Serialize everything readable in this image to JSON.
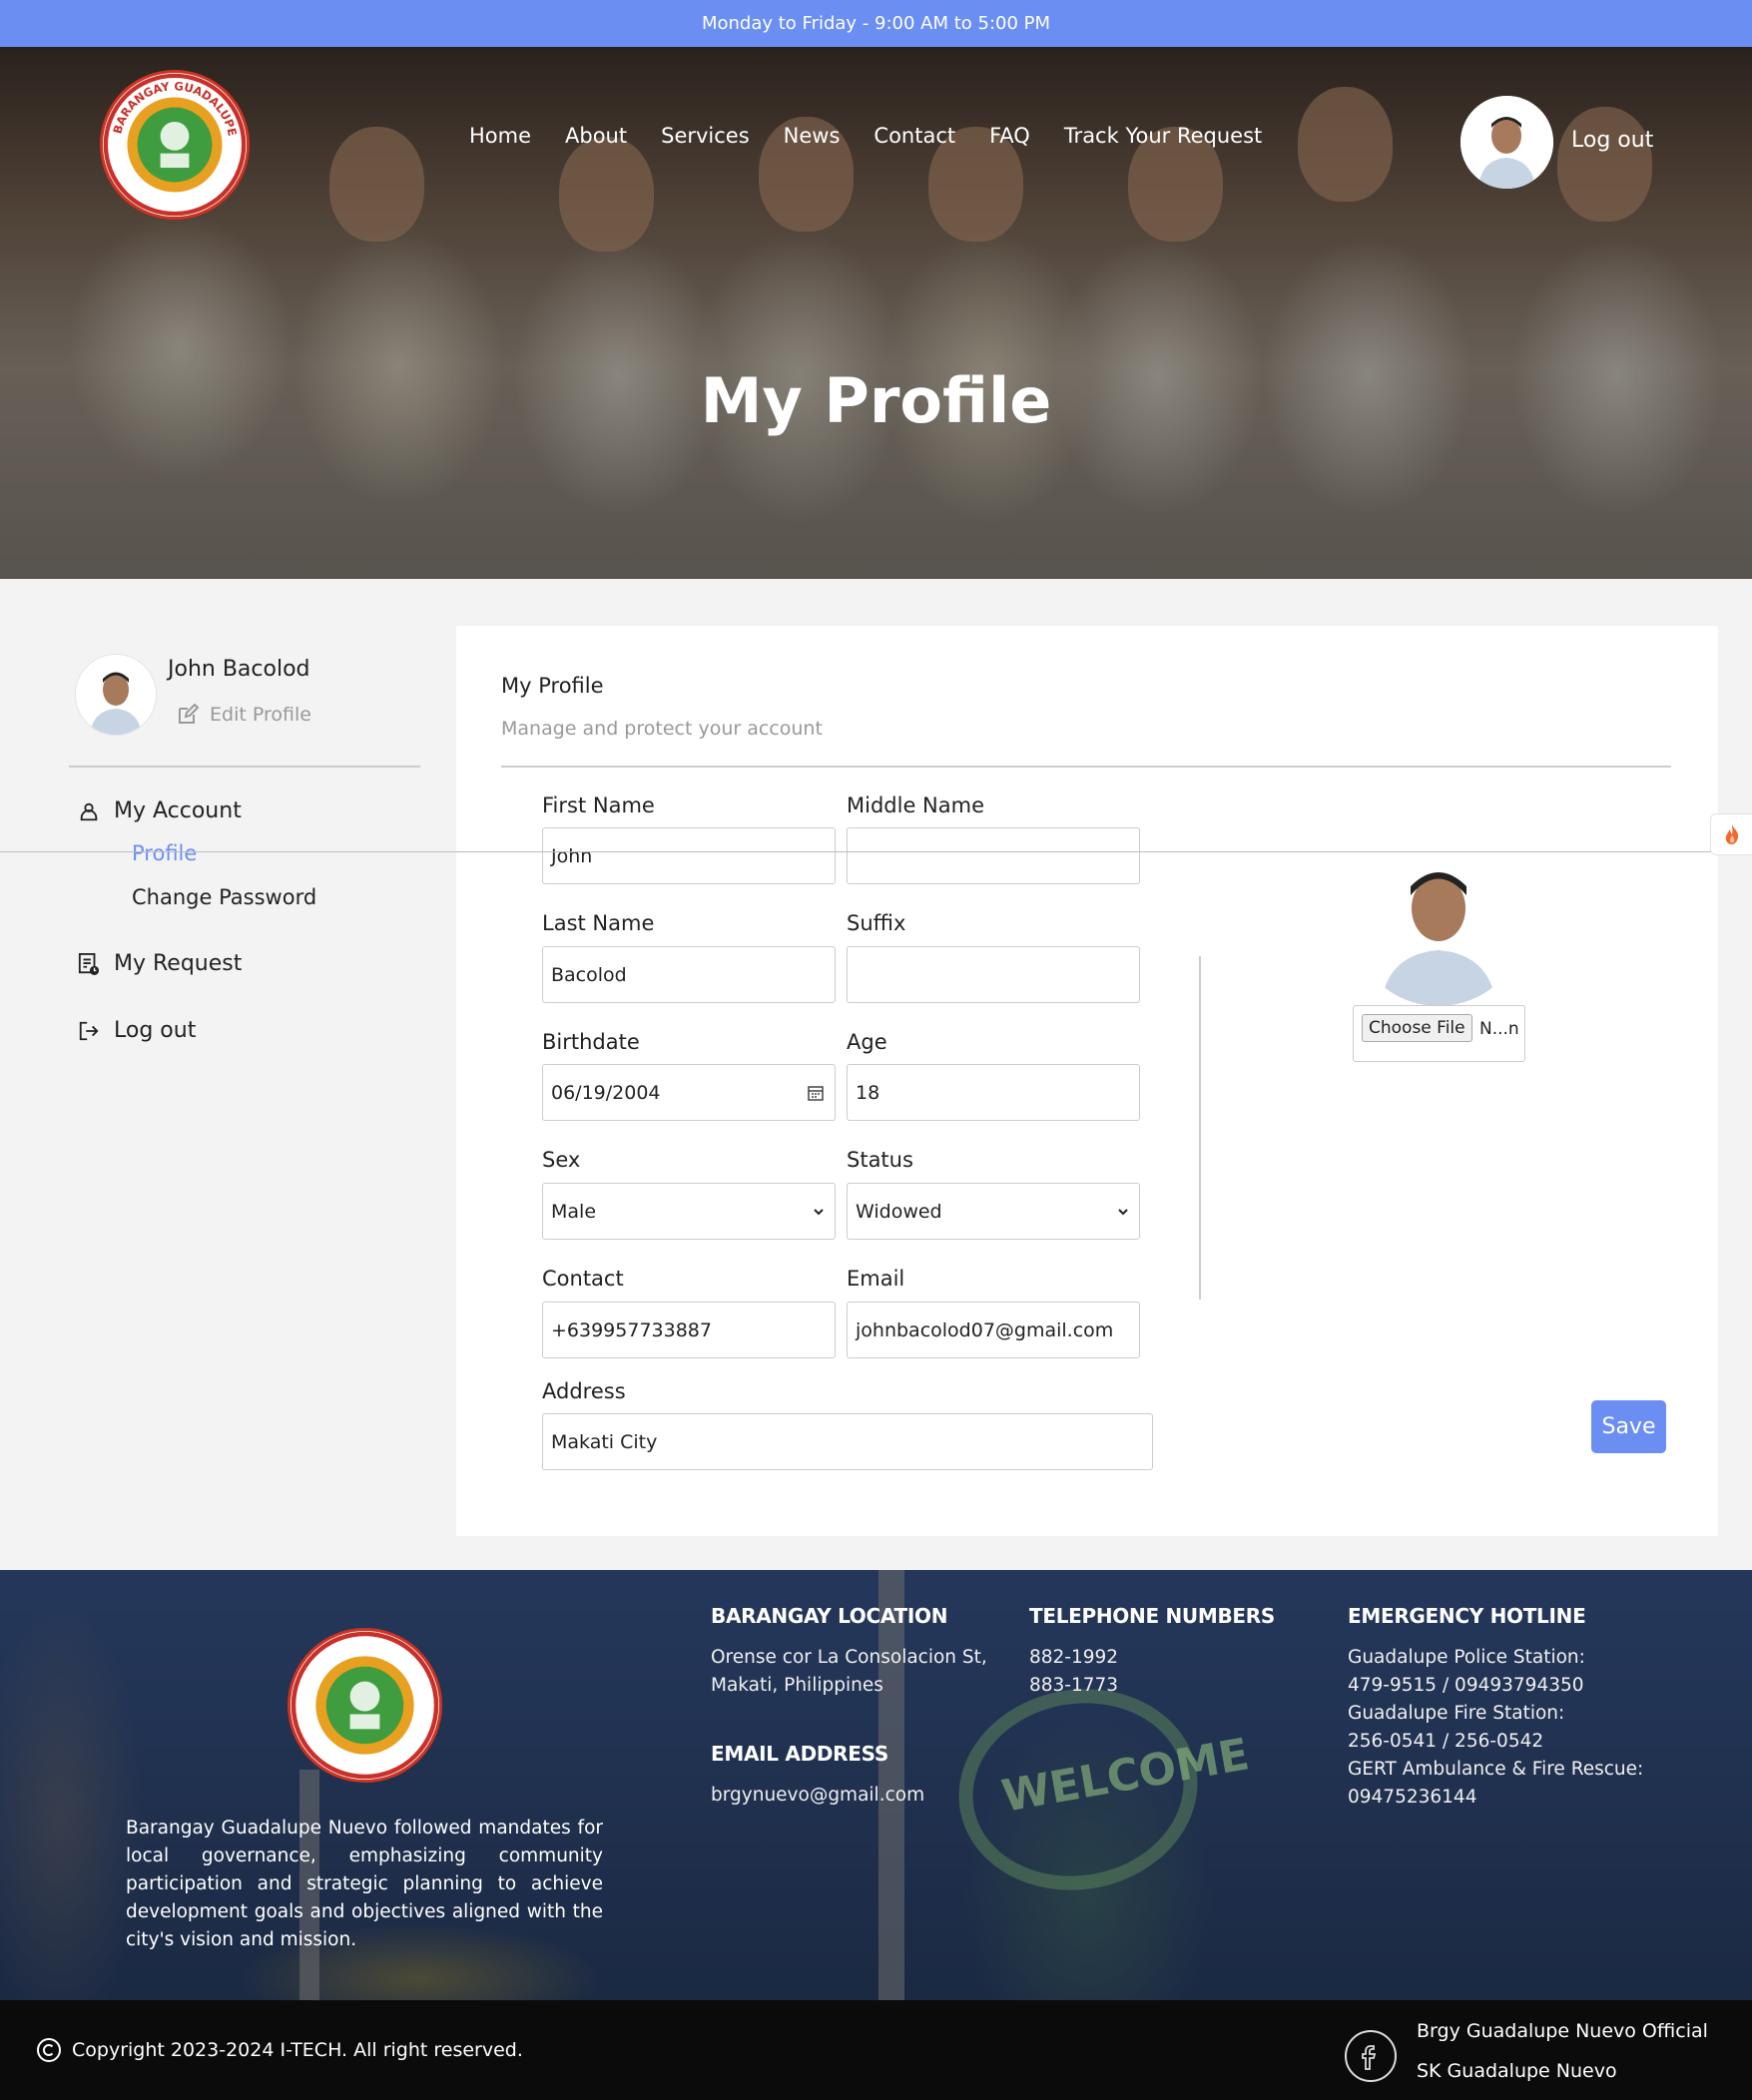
{
  "topbar": {
    "hours": "Monday to Friday - 9:00 AM to 5:00 PM"
  },
  "header": {
    "logo_text": "BARANGAY GUADALUPE NUEVO CITY OF MAKATI 2000",
    "nav": [
      "Home",
      "About",
      "Services",
      "News",
      "Contact",
      "FAQ",
      "Track Your Request"
    ],
    "logout": "Log out"
  },
  "hero": {
    "title": "My Profile"
  },
  "sidebar": {
    "name": "John Bacolod",
    "edit_profile": "Edit Profile",
    "my_account": "My Account",
    "profile": "Profile",
    "change_password": "Change Password",
    "my_request": "My Request",
    "logout": "Log out"
  },
  "form": {
    "title": "My Profile",
    "subtitle": "Manage and protect your account",
    "labels": {
      "first_name": "First Name",
      "middle_name": "Middle Name",
      "last_name": "Last Name",
      "suffix": "Suffix",
      "birthdate": "Birthdate",
      "age": "Age",
      "sex": "Sex",
      "status": "Status",
      "contact": "Contact",
      "email": "Email",
      "address": "Address"
    },
    "values": {
      "first_name": "John",
      "middle_name": "",
      "last_name": "Bacolod",
      "suffix": "",
      "birthdate": "06/19/2004",
      "age": "18",
      "sex": "Male",
      "status": "Widowed",
      "contact": "+639957733887",
      "email": "johnbacolod07@gmail.com",
      "address": "Makati City"
    },
    "choose_file": "Choose File",
    "file_name": "N...n",
    "save": "Save"
  },
  "footer": {
    "about": "Barangay Guadalupe Nuevo followed mandates for local governance, emphasizing community participation and strategic planning to achieve development goals and objectives aligned with the city's vision and mission.",
    "location_title": "BARANGAY LOCATION",
    "location_line1": "Orense cor La Consolacion St,",
    "location_line2": "Makati, Philippines",
    "email_title": "EMAIL ADDRESS",
    "email": "brgynuevo@gmail.com",
    "tel_title": "TELEPHONE NUMBERS",
    "tel1": "882-1992",
    "tel2": "883-1773",
    "emergency_title": "EMERGENCY HOTLINE",
    "emergency": [
      "Guadalupe Police Station:",
      "479-9515 / 09493794350",
      "Guadalupe Fire Station:",
      "256-0541 / 256-0542",
      "GERT Ambulance & Fire Rescue:",
      "09475236144"
    ],
    "sign_text": "WELCOME"
  },
  "bottom": {
    "copyright": "Copyright 2023-2024 I-TECH. All right reserved.",
    "fb1": "Brgy Guadalupe Nuevo Official",
    "fb2": "SK Guadalupe Nuevo"
  },
  "colors": {
    "accent": "#6b8ef2",
    "footer_bg": "#2b3f62"
  }
}
